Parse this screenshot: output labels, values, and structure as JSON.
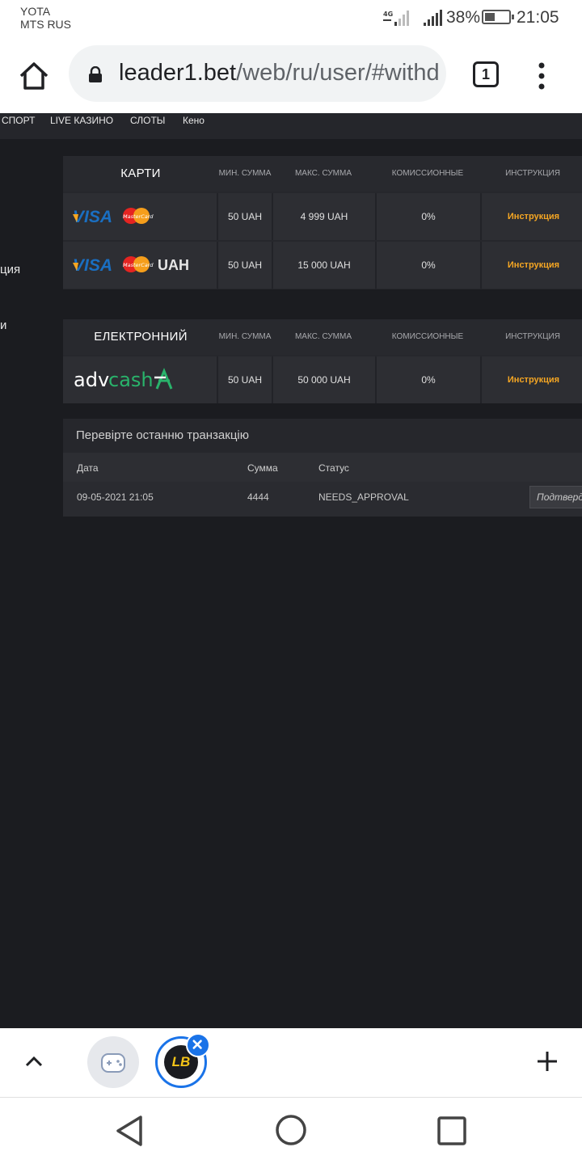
{
  "status_bar": {
    "carrier1": "YOTA",
    "carrier2": "MTS RUS",
    "network": "4G",
    "battery": "38%",
    "battery_level": 0.38,
    "time": "21:05"
  },
  "browser": {
    "url_host": "leader1.bet",
    "url_path": "/web/ru/user/#withd",
    "tab_count": "1"
  },
  "site_nav": {
    "items": [
      "СПОРТ",
      "LIVE КАЗИНО",
      "СЛОТЫ",
      "Кено"
    ]
  },
  "sidebar": {
    "frag1": "ция",
    "frag2": "и"
  },
  "cards_table": {
    "title": "КАРТИ",
    "headers": [
      "МИН. СУММА",
      "МАКС. СУММА",
      "КОМИССИОННЫЕ",
      "ИНСТРУКЦИЯ"
    ],
    "rows": [
      {
        "logo": "visa-mastercard",
        "logo_suffix": "",
        "visa_text": "VISA",
        "mc_text": "MasterCard",
        "min": "50 UAH",
        "max": "4 999 UAH",
        "fee": "0%",
        "instr": "Инструкция"
      },
      {
        "logo": "visa-mastercard",
        "logo_suffix": "UAH",
        "visa_text": "VISA",
        "mc_text": "MasterCard",
        "min": "50 UAH",
        "max": "15 000 UAH",
        "fee": "0%",
        "instr": "Инструкция"
      }
    ]
  },
  "ewallet_table": {
    "title": "ЕЛЕКТРОННИЙ",
    "headers": [
      "МИН. СУММА",
      "МАКС. СУММА",
      "КОМИССИОННЫЕ",
      "ИНСТРУКЦИЯ"
    ],
    "rows": [
      {
        "logo_a": "adv",
        "logo_b": "cash",
        "min": "50 UAH",
        "max": "50 000 UAH",
        "fee": "0%",
        "instr": "Инструкция"
      }
    ]
  },
  "transactions": {
    "title": "Перевірте останню транзакцію",
    "headers": {
      "date": "Дата",
      "amount": "Сумма",
      "status": "Статус"
    },
    "row": {
      "date": "09-05-2021 21:05",
      "amount": "4444",
      "status": "NEEDS_APPROVAL",
      "action": "Подтвердить"
    }
  },
  "bubbles": {
    "app_badge": "LB"
  },
  "colors": {
    "accent": "#f5a623",
    "bubble_blue": "#1a73e8",
    "bg": "#1b1c20"
  }
}
